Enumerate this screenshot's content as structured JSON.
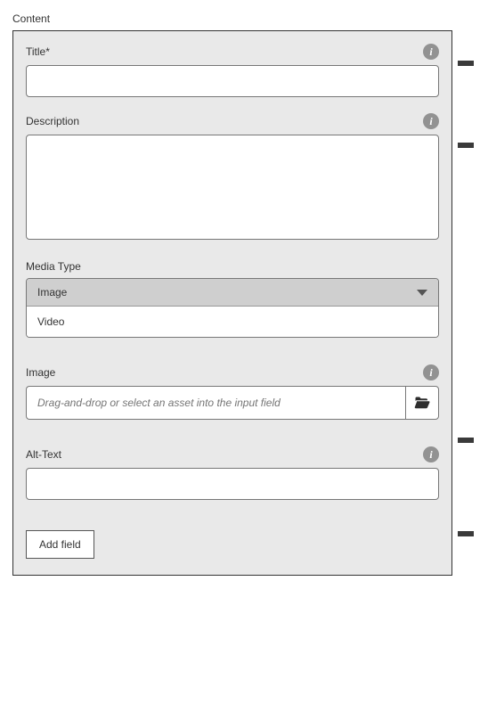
{
  "section_label": "Content",
  "fields": {
    "title": {
      "label": "Title*",
      "value": ""
    },
    "description": {
      "label": "Description",
      "value": ""
    },
    "media_type": {
      "label": "Media Type",
      "selected": "Image",
      "options": [
        "Video"
      ]
    },
    "image": {
      "label": "Image",
      "placeholder": "Drag-and-drop or select an asset into the input field"
    },
    "alt_text": {
      "label": "Alt-Text",
      "value": ""
    }
  },
  "buttons": {
    "add_field": "Add field"
  },
  "icons": {
    "info": "i"
  }
}
